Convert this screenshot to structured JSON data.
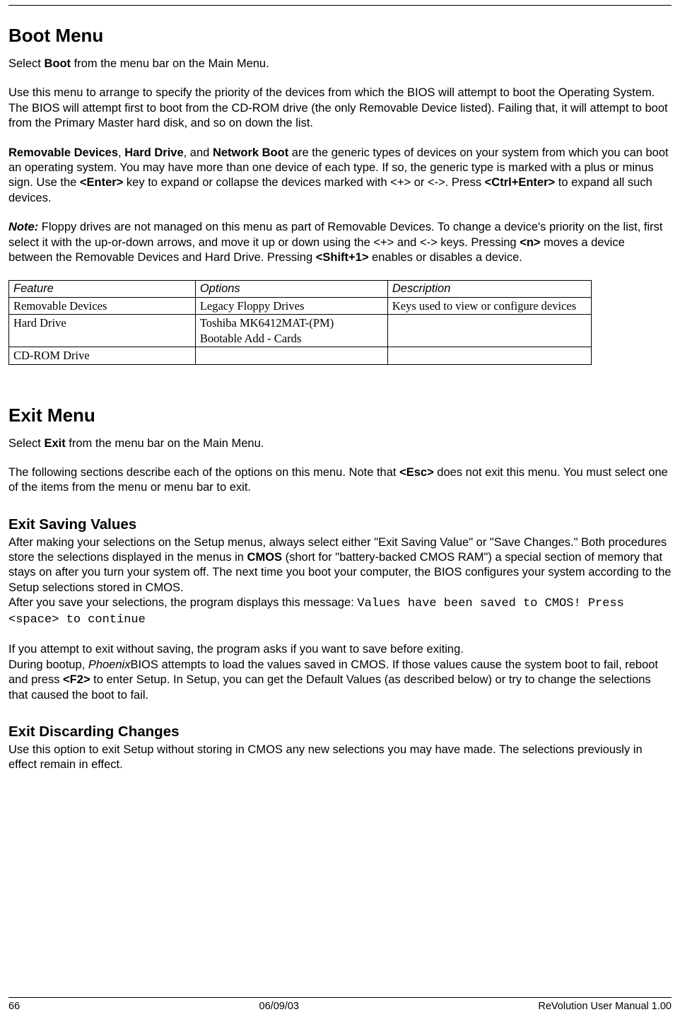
{
  "boot": {
    "heading": "Boot Menu",
    "p1_a": "Select ",
    "p1_b": "Boot",
    "p1_c": " from the menu bar on the Main Menu.",
    "p2": "Use this menu to arrange to specify the priority of the devices from which the BIOS will attempt to boot the Operating System. The BIOS will attempt first to boot from the CD-ROM drive (the only Removable Device listed). Failing that, it will attempt to boot from the Primary Master hard disk, and so on down the list.",
    "p3_a": "Removable Devices",
    "p3_b": ", ",
    "p3_c": "Hard Drive",
    "p3_d": ", and ",
    "p3_e": "Network Boot",
    "p3_f": " are the generic types of devices on your system from which you can boot an operating system. You may have more than one device of each type. If so, the generic type is marked with a plus or minus sign. Use the ",
    "p3_g": "<Enter>",
    "p3_h": " key to expand or collapse the devices marked with <+> or <->. Press ",
    "p3_i": "<Ctrl+Enter>",
    "p3_j": " to expand all such devices.",
    "p4_a": "Note:",
    "p4_b": " Floppy drives are not managed on this menu as part of Removable Devices. To change a device's priority on the list, first select it with the up-or-down arrows, and move it up or down using the <+> and <-> keys. Pressing ",
    "p4_c": "<n>",
    "p4_d": " moves a device between the Removable Devices and Hard Drive. Pressing ",
    "p4_e": "<Shift+1>",
    "p4_f": " enables or disables a device."
  },
  "table": {
    "headers": {
      "feature": "Feature",
      "options": "Options",
      "description": "Description"
    },
    "rows": [
      {
        "feature": "Removable Devices",
        "options": "Legacy Floppy Drives",
        "description": "Keys used to view or configure devices"
      },
      {
        "feature": "Hard Drive",
        "options_l1": "Toshiba MK6412MAT-(PM)",
        "options_l2": "Bootable Add - Cards",
        "description": ""
      },
      {
        "feature": "CD-ROM Drive",
        "options": "",
        "description": ""
      }
    ]
  },
  "exit": {
    "heading": "Exit Menu",
    "p1_a": "Select ",
    "p1_b": "Exit",
    "p1_c": " from the menu bar on the Main Menu.",
    "p2_a": "The following sections describe each of the options on this menu. Note that ",
    "p2_b": "<Esc>",
    "p2_c": " does not exit this menu. You must select one of the items from the menu or menu bar to exit."
  },
  "saving": {
    "heading": "Exit Saving Values",
    "p1_a": "After making your selections on the Setup menus, always select either \"Exit Saving Value\" or \"Save Changes.\" Both procedures store the selections displayed in the menus in ",
    "p1_b": "CMOS",
    "p1_c": " (short for \"battery-backed CMOS RAM\") a special section of memory that stays on after you turn your system off. The next time you boot your computer, the BIOS configures your system according to the Setup selections stored in CMOS.",
    "p2_a": "After you save your selections, the program displays this message: ",
    "p2_code": "Values have been saved to CMOS! Press <space> to continue",
    "p3": "If you attempt to exit without saving, the program asks if you want to save before exiting.",
    "p4_a": "During bootup, ",
    "p4_b": "Phoenix",
    "p4_c": "BIOS attempts to load the values saved in CMOS. If those values cause the system boot to fail, reboot and press ",
    "p4_d": "<F2>",
    "p4_e": " to enter Setup. In Setup, you can get the Default Values (as described below) or try to change the selections that caused the boot to fail."
  },
  "discard": {
    "heading": "Exit Discarding Changes",
    "p1": "Use this option to exit Setup without storing in CMOS any new selections you may have made. The selections previously in effect remain in effect."
  },
  "footer": {
    "page": "66",
    "date": "06/09/03",
    "doc": "ReVolution User Manual 1.00"
  }
}
